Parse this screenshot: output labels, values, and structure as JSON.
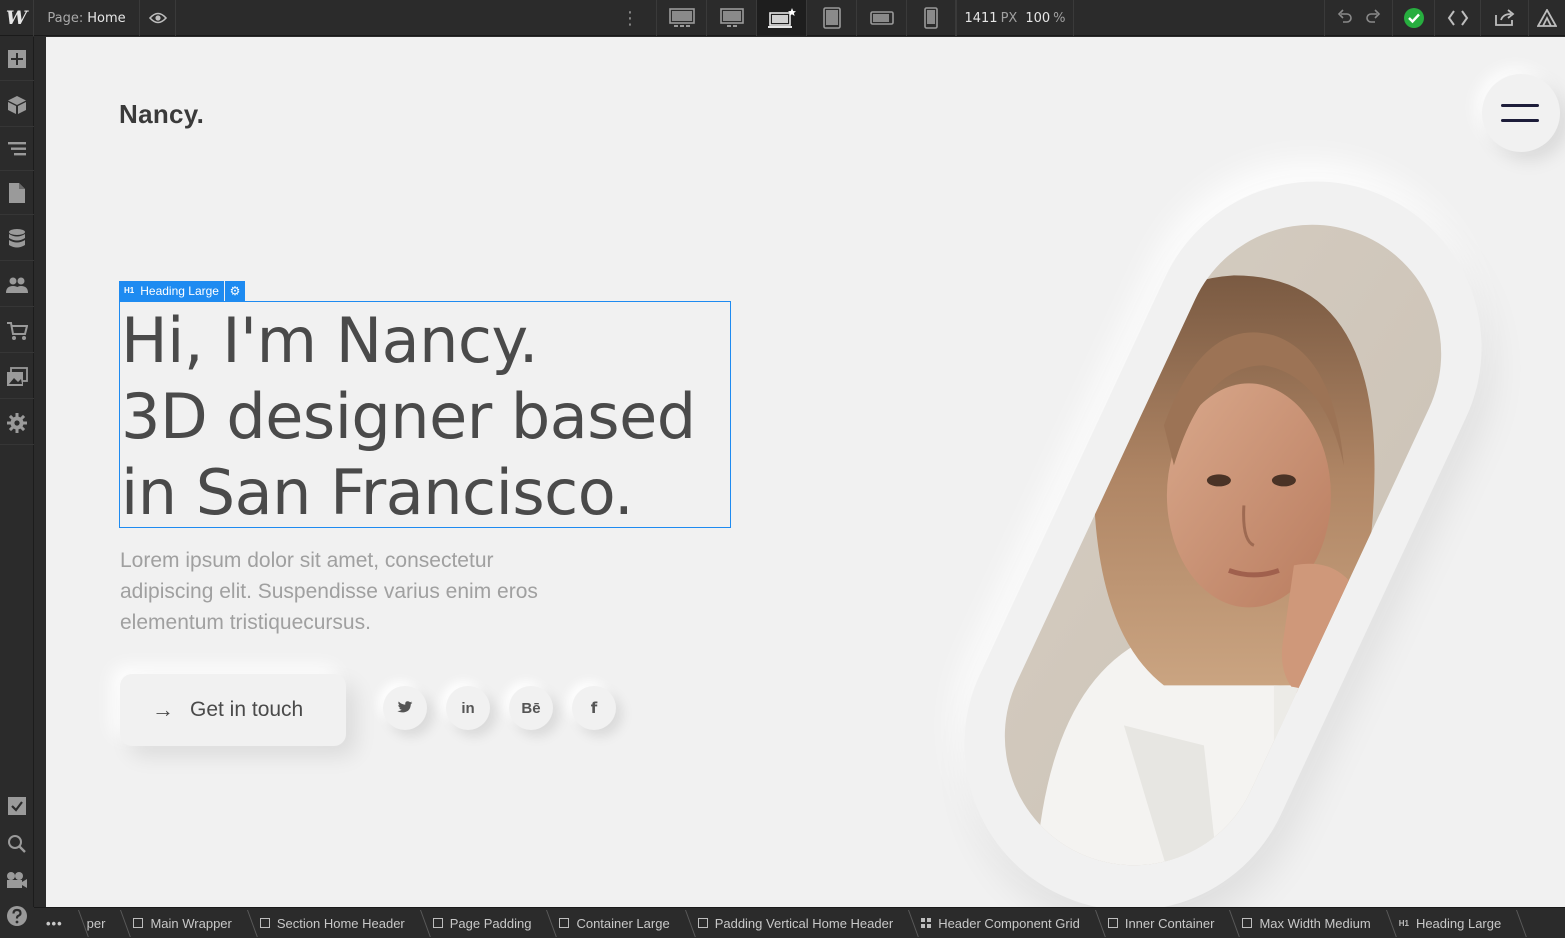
{
  "topbar": {
    "logo": "W",
    "page_prefix": "Page:",
    "page_name": "Home",
    "width_value": "1411",
    "width_unit": "PX",
    "zoom_value": "100",
    "zoom_unit": "%",
    "breakpoints": [
      "desktop-large-icon",
      "desktop-medium-icon",
      "desktop-base-icon",
      "tablet-icon",
      "mobile-landscape-icon",
      "mobile-portrait-icon"
    ],
    "active_breakpoint": "desktop-base-icon",
    "status_color": "#27ae3f",
    "accent": "#1e8bf1"
  },
  "sidebar": {
    "items": [
      "add-icon",
      "components-icon",
      "navigator-icon",
      "pages-icon",
      "cms-icon",
      "users-icon",
      "ecommerce-icon",
      "assets-icon",
      "settings-icon"
    ],
    "bottom_items": [
      "tasks-icon",
      "search-icon",
      "video-icon",
      "help-icon"
    ]
  },
  "canvas": {
    "brand": "Nancy.",
    "selection_label": "Heading Large",
    "selection_tag": "H1",
    "heading_lines": [
      "Hi, I'm Nancy.",
      "3D designer based",
      "in San Francisco."
    ],
    "lead": "Lorem ipsum dolor sit amet, consectetur adipiscing elit. Suspendisse varius enim eros elementum tristiquecursus.",
    "cta_label": "Get in touch",
    "socials": [
      {
        "name": "twitter-icon",
        "glyph": ""
      },
      {
        "name": "linkedin-icon",
        "glyph": "in"
      },
      {
        "name": "behance-icon",
        "glyph": "Bē"
      },
      {
        "name": "facebook-icon",
        "glyph": "f"
      }
    ]
  },
  "breadcrumbs": {
    "more": "•••",
    "items": [
      {
        "label": "per",
        "icon": "none"
      },
      {
        "label": "Main Wrapper",
        "icon": "box"
      },
      {
        "label": "Section Home Header",
        "icon": "box"
      },
      {
        "label": "Page Padding",
        "icon": "box"
      },
      {
        "label": "Container Large",
        "icon": "box"
      },
      {
        "label": "Padding Vertical Home Header",
        "icon": "box"
      },
      {
        "label": "Header Component Grid",
        "icon": "grid"
      },
      {
        "label": "Inner Container",
        "icon": "box"
      },
      {
        "label": "Max Width Medium",
        "icon": "box"
      },
      {
        "label": "Heading Large",
        "icon": "h1"
      }
    ]
  }
}
